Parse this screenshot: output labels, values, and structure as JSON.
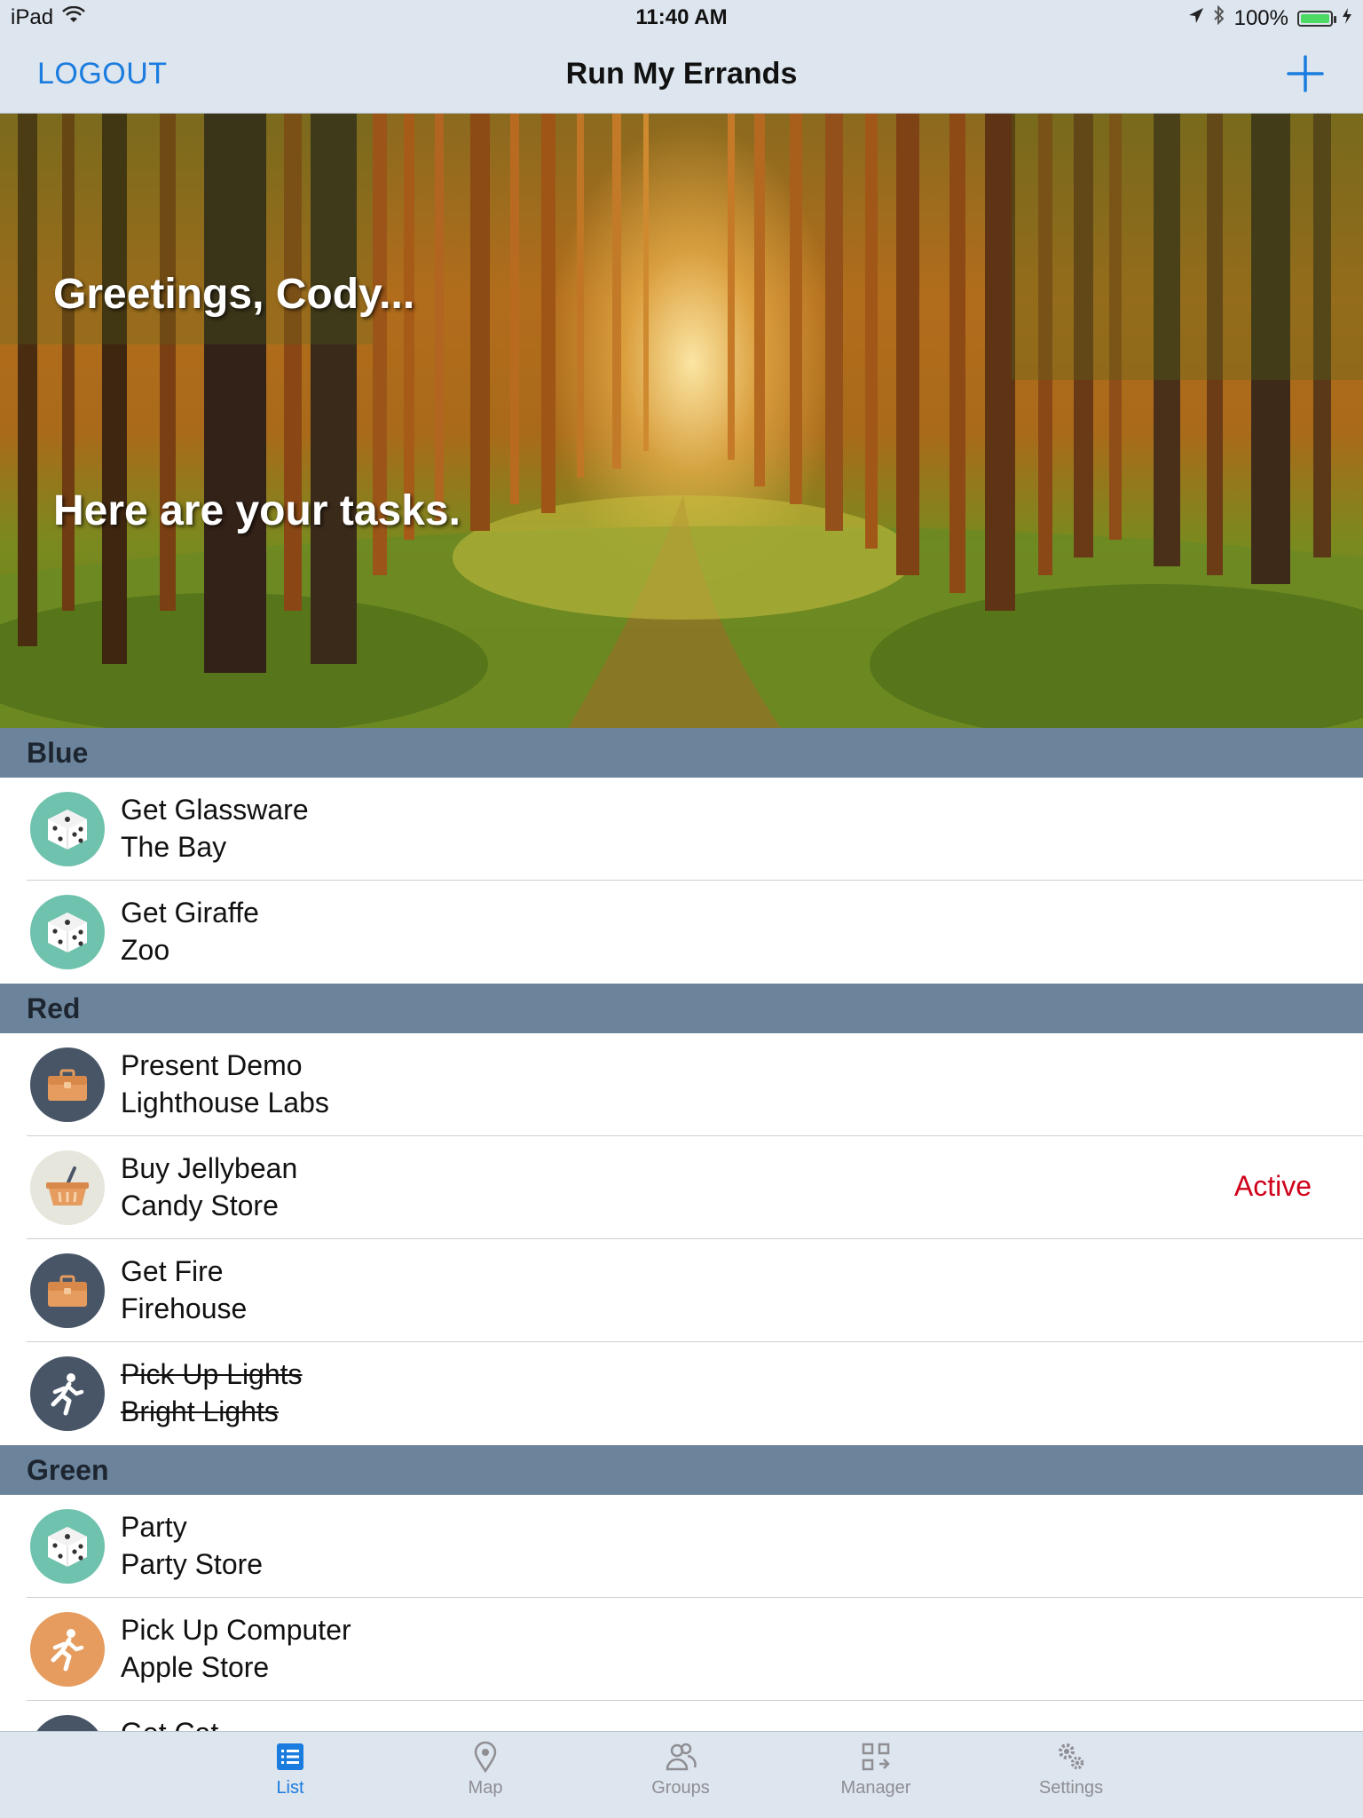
{
  "status_bar": {
    "device": "iPad",
    "time": "11:40 AM",
    "battery": "100%",
    "battery_level": 1.0
  },
  "nav": {
    "logout_label": "LOGOUT",
    "title": "Run My Errands",
    "add_icon": "plus-icon"
  },
  "hero": {
    "greeting": "Greetings, Cody...",
    "subtitle": "Here are your tasks."
  },
  "sections": [
    {
      "name": "Blue",
      "items": [
        {
          "title": "Get Glassware",
          "subtitle": "The Bay",
          "icon": "dice-icon",
          "icon_bg": "#6fc2ad",
          "status": "",
          "done": false
        },
        {
          "title": "Get Giraffe",
          "subtitle": "Zoo",
          "icon": "dice-icon",
          "icon_bg": "#6fc2ad",
          "status": "",
          "done": false
        }
      ]
    },
    {
      "name": "Red",
      "items": [
        {
          "title": "Present Demo",
          "subtitle": "Lighthouse Labs",
          "icon": "briefcase-icon",
          "icon_bg": "#475567",
          "status": "",
          "done": false
        },
        {
          "title": "Buy Jellybean",
          "subtitle": "Candy Store",
          "icon": "basket-icon",
          "icon_bg": "#e6e6dc",
          "status": "Active",
          "done": false
        },
        {
          "title": "Get Fire",
          "subtitle": "Firehouse",
          "icon": "briefcase-icon",
          "icon_bg": "#475567",
          "status": "",
          "done": false
        },
        {
          "title": "Pick Up Lights",
          "subtitle": "Bright Lights",
          "icon": "runner-icon",
          "icon_bg": "#475567",
          "status": "",
          "done": true
        }
      ]
    },
    {
      "name": "Green",
      "items": [
        {
          "title": "Party",
          "subtitle": "Party Store",
          "icon": "dice-icon",
          "icon_bg": "#6fc2ad",
          "status": "",
          "done": false
        },
        {
          "title": "Pick Up Computer",
          "subtitle": "Apple Store",
          "icon": "runner-icon",
          "icon_bg": "#e59c5e",
          "status": "",
          "done": false
        },
        {
          "title": "Get Cat",
          "subtitle": "",
          "icon": "briefcase-icon",
          "icon_bg": "#475567",
          "status": "",
          "done": false
        }
      ]
    }
  ],
  "tabs": [
    {
      "label": "List",
      "icon": "list-icon",
      "active": true
    },
    {
      "label": "Map",
      "icon": "map-pin-icon",
      "active": false
    },
    {
      "label": "Groups",
      "icon": "groups-icon",
      "active": false
    },
    {
      "label": "Manager",
      "icon": "manager-icon",
      "active": false
    },
    {
      "label": "Settings",
      "icon": "gears-icon",
      "active": false
    }
  ],
  "colors": {
    "accent": "#1a7cdf",
    "status_active": "#d0021b",
    "section_header": "#6b849b"
  }
}
